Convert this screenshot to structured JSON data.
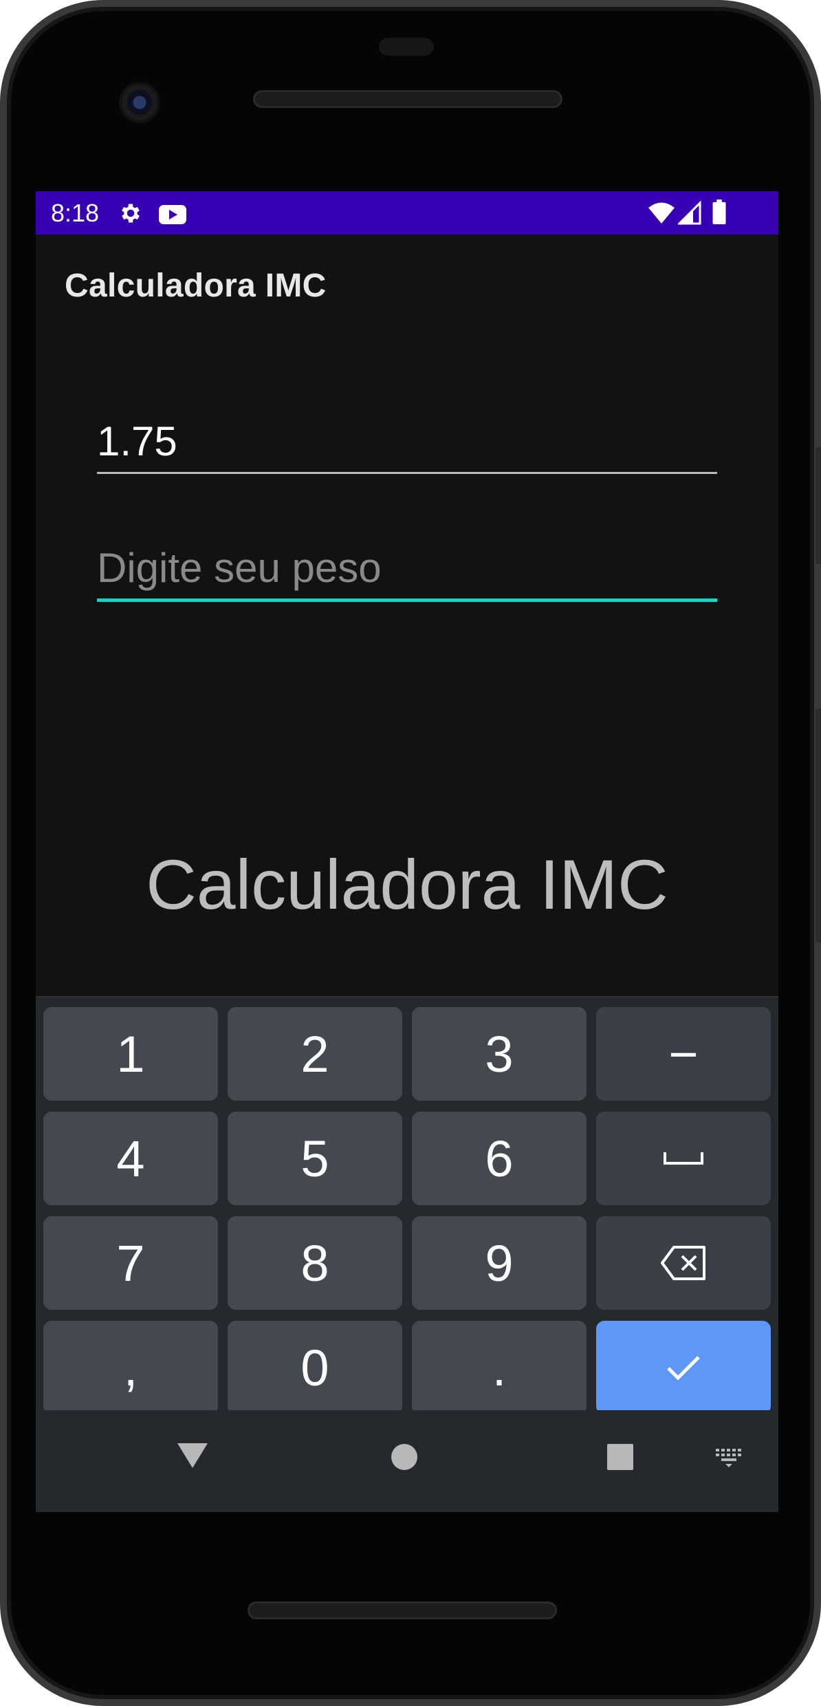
{
  "status_bar": {
    "time": "8:18",
    "icons": [
      "settings-icon",
      "youtube-icon",
      "wifi-icon",
      "signal-icon",
      "battery-icon"
    ],
    "color": "#3700b3"
  },
  "app_bar": {
    "title": "Calculadora IMC"
  },
  "form": {
    "height_value": "1.75",
    "weight_value": "",
    "weight_placeholder": "Digite seu peso",
    "focus_color": "#03dac5"
  },
  "result": {
    "text": "Calculadora IMC"
  },
  "keyboard": {
    "row1": [
      "1",
      "2",
      "3",
      "−"
    ],
    "row2": [
      "4",
      "5",
      "6"
    ],
    "row3": [
      "7",
      "8",
      "9"
    ],
    "row4": [
      ",",
      "0",
      "."
    ],
    "icons": [
      "space-icon",
      "backspace-icon",
      "check-icon"
    ],
    "enter_color": "#5e97f6"
  },
  "nav_bar": {
    "icons": [
      "back-icon",
      "home-icon",
      "recents-icon",
      "keyboard-switch-icon"
    ]
  }
}
